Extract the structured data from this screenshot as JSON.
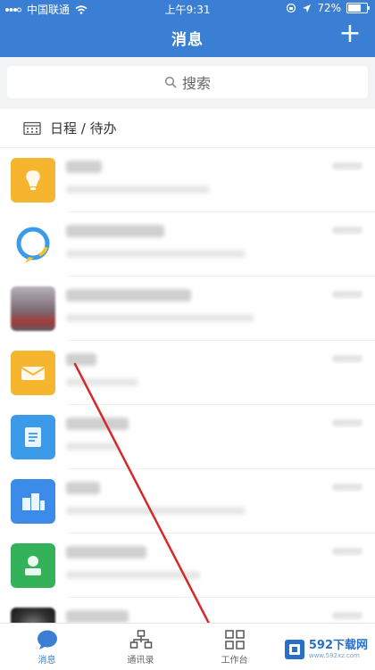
{
  "status_bar": {
    "carrier": "中国联通",
    "time": "上午9:31",
    "battery": "72%",
    "battery_level": 0.72
  },
  "header": {
    "title": "消息",
    "add_label": "+"
  },
  "search": {
    "placeholder": "搜索"
  },
  "schedule": {
    "label": "日程 / 待办"
  },
  "list": {
    "items": [
      {
        "icon": "bulb-icon",
        "color": "#f5b52e"
      },
      {
        "icon": "chat-bubble-icon",
        "color": "#ffffff"
      },
      {
        "icon": "photo-avatar",
        "color": "#8a7b8a"
      },
      {
        "icon": "envelope-icon",
        "color": "#f5b52e"
      },
      {
        "icon": "document-icon",
        "color": "#3c9be8"
      },
      {
        "icon": "building-icon",
        "color": "#3c8be8"
      },
      {
        "icon": "person-icon",
        "color": "#33b25a"
      },
      {
        "icon": "photo-avatar",
        "color": "#3a3a3a"
      }
    ]
  },
  "bottom_nav": {
    "items": [
      {
        "label": "消息",
        "icon": "message-icon",
        "active": true
      },
      {
        "label": "通讯录",
        "icon": "contacts-icon",
        "active": false
      },
      {
        "label": "工作台",
        "icon": "workbench-icon",
        "active": false
      },
      {
        "label": "",
        "icon": "",
        "active": false
      }
    ]
  },
  "watermark": {
    "text": "592下载网",
    "url": "www.592xz.com"
  },
  "colors": {
    "brand": "#3b7fd4",
    "annotation": "#d62a2a"
  }
}
